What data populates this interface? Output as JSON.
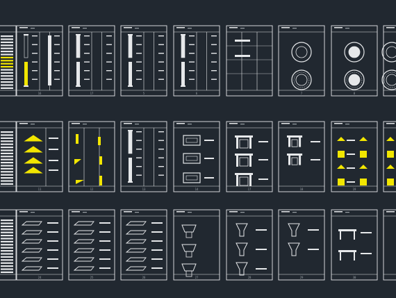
{
  "app": {
    "view": "CAD model space",
    "background": "#212830"
  },
  "colors": {
    "line": "#e6e8ea",
    "accent": "#f2e600",
    "text_dim": "#9aa0a6"
  },
  "sheet_captions": {
    "row1": [
      "",
      "16",
      "17",
      "5",
      "6",
      "",
      "7",
      "8",
      ""
    ],
    "row2": [
      "",
      "11",
      "12",
      "13",
      "14",
      "17",
      "18",
      "19",
      ""
    ],
    "row3": [
      "",
      "24",
      "25",
      "26",
      "27",
      "28",
      "29",
      "30",
      ""
    ]
  },
  "rows": [
    {
      "id": "row1",
      "sheets": [
        {
          "kind": "cut-list",
          "accent": true
        },
        {
          "kind": "columns",
          "accent": true
        },
        {
          "kind": "columns",
          "accent": false
        },
        {
          "kind": "columns",
          "accent": false
        },
        {
          "kind": "columns",
          "accent": false
        },
        {
          "kind": "table-plain",
          "accent": false
        },
        {
          "kind": "rosettes",
          "accent": false
        },
        {
          "kind": "rosettes-filled",
          "accent": false
        },
        {
          "kind": "rosettes-cut",
          "accent": false
        }
      ]
    },
    {
      "id": "row2",
      "sheets": [
        {
          "kind": "cut-list",
          "accent": false
        },
        {
          "kind": "pediments",
          "accent": true
        },
        {
          "kind": "corbels",
          "accent": true
        },
        {
          "kind": "columns",
          "accent": false
        },
        {
          "kind": "frames",
          "accent": false
        },
        {
          "kind": "fireplaces",
          "accent": false
        },
        {
          "kind": "fireplaces-small",
          "accent": false
        },
        {
          "kind": "ornaments",
          "accent": true
        },
        {
          "kind": "ornaments-cut",
          "accent": true
        }
      ]
    },
    {
      "id": "row3",
      "sheets": [
        {
          "kind": "cut-list",
          "accent": false
        },
        {
          "kind": "moldings",
          "accent": false
        },
        {
          "kind": "moldings",
          "accent": false
        },
        {
          "kind": "moldings-small",
          "accent": false
        },
        {
          "kind": "capitals",
          "accent": false
        },
        {
          "kind": "pedestals",
          "accent": false
        },
        {
          "kind": "pedestals-small",
          "accent": false
        },
        {
          "kind": "tables",
          "accent": false
        },
        {
          "kind": "cut-list-right",
          "accent": false
        }
      ]
    }
  ]
}
